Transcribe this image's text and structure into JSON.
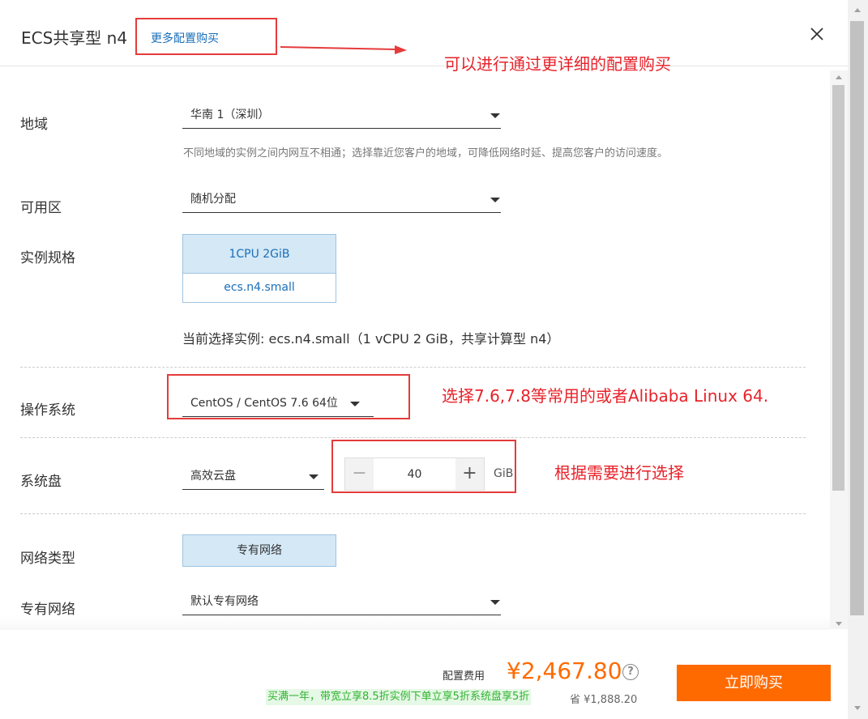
{
  "header": {
    "title": "ECS共享型 n4",
    "more_link": "更多配置购买"
  },
  "form": {
    "region": {
      "label": "地域",
      "value": "华南 1（深圳）",
      "hint": "不同地域的实例之间内网互不相通；选择靠近您客户的地域，可降低网络时延、提高您客户的访问速度。"
    },
    "zone": {
      "label": "可用区",
      "value": "随机分配"
    },
    "spec": {
      "label": "实例规格",
      "cpu_mem": "1CPU 2GiB",
      "name": "ecs.n4.small",
      "current": "当前选择实例: ecs.n4.small（1 vCPU 2 GiB，共享计算型 n4）"
    },
    "os": {
      "label": "操作系统",
      "value": "CentOS / CentOS 7.6 64位"
    },
    "disk": {
      "label": "系统盘",
      "type": "高效云盘",
      "minus": "−",
      "size": "40",
      "plus": "+",
      "unit": "GiB"
    },
    "network_type": {
      "label": "网络类型",
      "value": "专有网络"
    },
    "vpc": {
      "label": "专有网络",
      "value": "默认专有网络"
    }
  },
  "annotations": {
    "note_more": "可以进行通过更详细的配置购买",
    "note_os": "选择7.6,7.8等常用的或者Alibaba Linux 64.",
    "note_disk": "根据需要进行选择",
    "color": "#e8222a"
  },
  "footer": {
    "price_label": "配置费用",
    "price": "¥2,467.80",
    "help": "?",
    "promo": "买满一年，带宽立享8.5折实例下单立享5折系统盘享5折",
    "save": "省 ¥1,888.20",
    "buy_label": "立即购买"
  },
  "colors": {
    "accent_orange": "#ff6a00",
    "link_blue": "#1a6fb8",
    "selected_bg": "#d4e8f6",
    "promo_green": "#2fb32f"
  },
  "icons": {
    "close": "close-icon",
    "dropdown": "chevron-down-icon",
    "help": "question-icon"
  }
}
